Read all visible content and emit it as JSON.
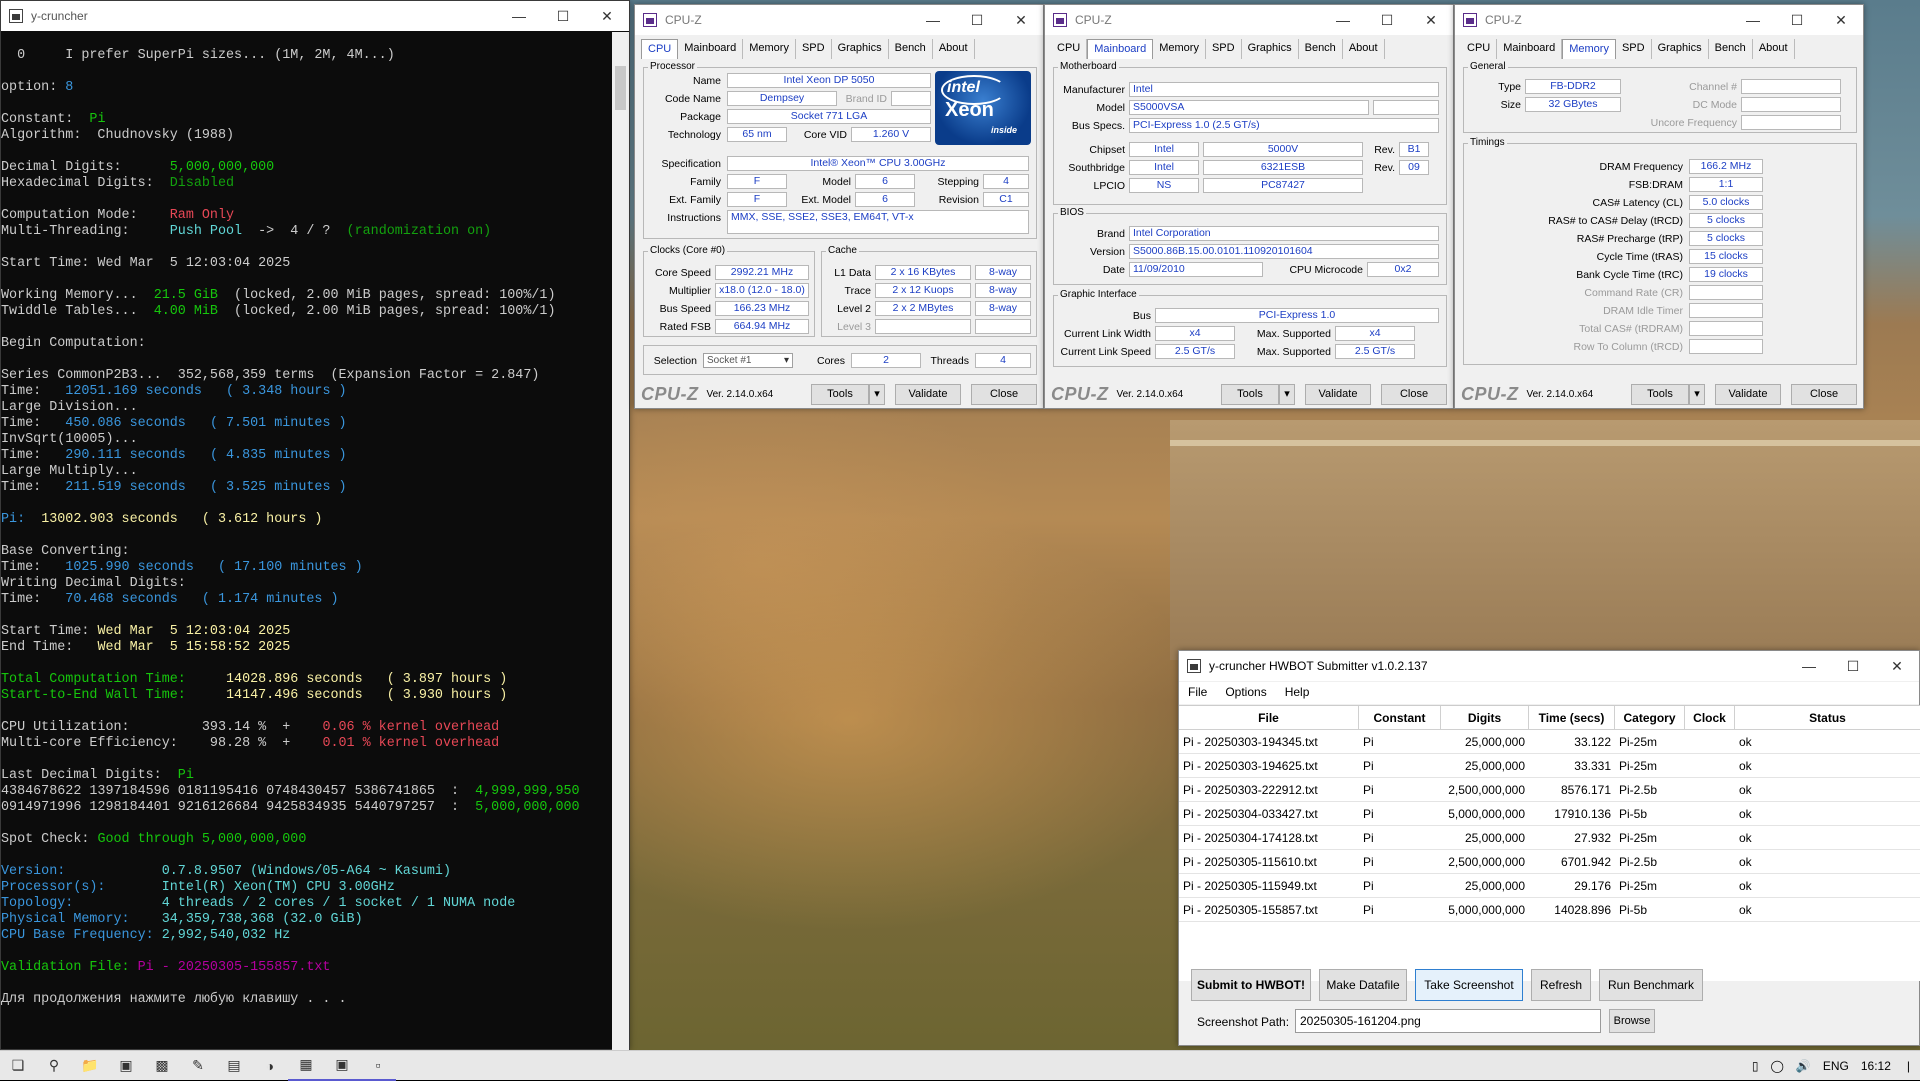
{
  "console": {
    "title": "y-cruncher",
    "lines": [
      [
        [
          "w",
          "  0     I prefer SuperPi sizes... (1M, 2M, 4M...)"
        ]
      ],
      [
        [
          "w",
          ""
        ]
      ],
      [
        [
          "w",
          "option: "
        ],
        [
          "c",
          "8"
        ]
      ],
      [
        [
          "w",
          ""
        ]
      ],
      [
        [
          "w",
          "Constant:  "
        ],
        [
          "g",
          "Pi"
        ]
      ],
      [
        [
          "w",
          "Algorithm:  Chudnovsky (1988)"
        ]
      ],
      [
        [
          "w",
          ""
        ]
      ],
      [
        [
          "w",
          "Decimal Digits:      "
        ],
        [
          "g",
          "5,000,000,000"
        ]
      ],
      [
        [
          "w",
          "Hexadecimal Digits:  "
        ],
        [
          "lg",
          "Disabled"
        ]
      ],
      [
        [
          "w",
          ""
        ]
      ],
      [
        [
          "w",
          "Computation Mode:    "
        ],
        [
          "r",
          "Ram Only"
        ]
      ],
      [
        [
          "w",
          "Multi-Threading:     "
        ],
        [
          "lc",
          "Push Pool"
        ],
        [
          "w",
          "  ->  4 / ?  "
        ],
        [
          "lg",
          "(randomization on)"
        ]
      ],
      [
        [
          "w",
          ""
        ]
      ],
      [
        [
          "w",
          "Start Time: Wed Mar  5 12:03:04 2025"
        ]
      ],
      [
        [
          "w",
          ""
        ]
      ],
      [
        [
          "w",
          "Working Memory...  "
        ],
        [
          "g",
          "21.5 GiB"
        ],
        [
          "w",
          "  (locked, 2.00 MiB pages, spread: 100%/1)"
        ]
      ],
      [
        [
          "w",
          "Twiddle Tables...  "
        ],
        [
          "g",
          "4.00 MiB"
        ],
        [
          "w",
          "  (locked, 2.00 MiB pages, spread: 100%/1)"
        ]
      ],
      [
        [
          "w",
          ""
        ]
      ],
      [
        [
          "w",
          "Begin Computation:"
        ]
      ],
      [
        [
          "w",
          ""
        ]
      ],
      [
        [
          "w",
          "Series CommonP2B3...  352,568,359 terms  (Expansion Factor = 2.847)"
        ]
      ],
      [
        [
          "w",
          "Time:   "
        ],
        [
          "c",
          "12051.169 seconds   ( 3.348 hours )"
        ]
      ],
      [
        [
          "w",
          "Large Division..."
        ]
      ],
      [
        [
          "w",
          "Time:   "
        ],
        [
          "c",
          "450.086 seconds   ( 7.501 minutes )"
        ]
      ],
      [
        [
          "w",
          "InvSqrt(10005)..."
        ]
      ],
      [
        [
          "w",
          "Time:   "
        ],
        [
          "c",
          "290.111 seconds   ( 4.835 minutes )"
        ]
      ],
      [
        [
          "w",
          "Large Multiply..."
        ]
      ],
      [
        [
          "w",
          "Time:   "
        ],
        [
          "c",
          "211.519 seconds   ( 3.525 minutes )"
        ]
      ],
      [
        [
          "w",
          ""
        ]
      ],
      [
        [
          "c",
          "Pi:  "
        ],
        [
          "y",
          "13002.903 seconds   ( 3.612 hours )"
        ]
      ],
      [
        [
          "w",
          ""
        ]
      ],
      [
        [
          "w",
          "Base Converting:"
        ]
      ],
      [
        [
          "w",
          "Time:   "
        ],
        [
          "c",
          "1025.990 seconds   ( 17.100 minutes )"
        ]
      ],
      [
        [
          "w",
          "Writing Decimal Digits:"
        ]
      ],
      [
        [
          "w",
          "Time:   "
        ],
        [
          "c",
          "70.468 seconds   ( 1.174 minutes )"
        ]
      ],
      [
        [
          "w",
          ""
        ]
      ],
      [
        [
          "w",
          "Start Time: "
        ],
        [
          "y",
          "Wed Mar  5 12:03:04 2025"
        ]
      ],
      [
        [
          "w",
          "End Time:   "
        ],
        [
          "y",
          "Wed Mar  5 15:58:52 2025"
        ]
      ],
      [
        [
          "w",
          ""
        ]
      ],
      [
        [
          "g",
          "Total Computation Time:     "
        ],
        [
          "y",
          "14028.896 seconds   ( 3.897 hours )"
        ]
      ],
      [
        [
          "g",
          "Start-to-End Wall Time:     "
        ],
        [
          "y",
          "14147.496 seconds   ( 3.930 hours )"
        ]
      ],
      [
        [
          "w",
          ""
        ]
      ],
      [
        [
          "w",
          "CPU Utilization:         393.14 %  +    "
        ],
        [
          "r",
          "0.06 % kernel overhead"
        ]
      ],
      [
        [
          "w",
          "Multi-core Efficiency:    98.28 %  +    "
        ],
        [
          "r",
          "0.01 % kernel overhead"
        ]
      ],
      [
        [
          "w",
          ""
        ]
      ],
      [
        [
          "w",
          "Last Decimal Digits:  "
        ],
        [
          "g",
          "Pi"
        ]
      ],
      [
        [
          "w",
          "4384678622 1397184596 0181195416 0748430457 5386741865  :  "
        ],
        [
          "g",
          "4,999,999,950"
        ]
      ],
      [
        [
          "w",
          "0914971996 1298184401 9216126684 9425834935 5440797257  :  "
        ],
        [
          "g",
          "5,000,000,000"
        ]
      ],
      [
        [
          "w",
          ""
        ]
      ],
      [
        [
          "w",
          "Spot Check: "
        ],
        [
          "g",
          "Good through 5,000,000,000"
        ]
      ],
      [
        [
          "w",
          ""
        ]
      ],
      [
        [
          "c",
          "Version:            "
        ],
        [
          "lc",
          "0.7.8.9507 (Windows/05-A64 ~ Kasumi)"
        ]
      ],
      [
        [
          "c",
          "Processor(s):       "
        ],
        [
          "lc",
          "Intel(R) Xeon(TM) CPU 3.00GHz"
        ]
      ],
      [
        [
          "c",
          "Topology:           "
        ],
        [
          "lc",
          "4 threads / 2 cores / 1 socket / 1 NUMA node"
        ]
      ],
      [
        [
          "c",
          "Physical Memory:    "
        ],
        [
          "lc",
          "34,359,738,368 (32.0 GiB)"
        ]
      ],
      [
        [
          "c",
          "CPU Base Frequency: "
        ],
        [
          "lc",
          "2,992,540,032 Hz"
        ]
      ],
      [
        [
          "w",
          ""
        ]
      ],
      [
        [
          "g",
          "Validation File: "
        ],
        [
          "m",
          "Pi - 20250305-155857.txt"
        ]
      ],
      [
        [
          "w",
          ""
        ]
      ],
      [
        [
          "w",
          "Для продолжения нажмите любую клавишу . . ."
        ]
      ]
    ]
  },
  "cpuz_common": {
    "title": "CPU-Z",
    "tabs": [
      "CPU",
      "Mainboard",
      "Memory",
      "SPD",
      "Graphics",
      "Bench",
      "About"
    ],
    "logo": "CPU-Z",
    "version": "Ver. 2.14.0.x64",
    "tools": "Tools",
    "validate": "Validate",
    "close": "Close"
  },
  "cpu": {
    "processor_group": "Processor",
    "name_l": "Name",
    "name": "Intel Xeon DP 5050",
    "code_l": "Code Name",
    "code": "Dempsey",
    "brand_l": "Brand ID",
    "pkg_l": "Package",
    "pkg": "Socket 771 LGA",
    "tech_l": "Technology",
    "tech": "65 nm",
    "vid_l": "Core VID",
    "vid": "1.260 V",
    "spec_l": "Specification",
    "spec": "Intel® Xeon™ CPU 3.00GHz",
    "fam_l": "Family",
    "fam": "F",
    "model_l": "Model",
    "model": "6",
    "step_l": "Stepping",
    "step": "4",
    "efam_l": "Ext. Family",
    "efam": "F",
    "emodel_l": "Ext. Model",
    "emodel": "6",
    "rev_l": "Revision",
    "rev": "C1",
    "instr_l": "Instructions",
    "instr": "MMX, SSE, SSE2, SSE3, EM64T, VT-x",
    "clocks_group": "Clocks (Core #0)",
    "cs_l": "Core Speed",
    "cs": "2992.21 MHz",
    "mul_l": "Multiplier",
    "mul": "x18.0 (12.0 - 18.0)",
    "bus_l": "Bus Speed",
    "bus": "166.23 MHz",
    "fsb_l": "Rated FSB",
    "fsb": "664.94 MHz",
    "cache_group": "Cache",
    "l1_l": "L1 Data",
    "l1": "2 x 16 KBytes",
    "l1w": "8-way",
    "tr_l": "Trace",
    "tr": "2 x 12 Kuops",
    "trw": "8-way",
    "l2_l": "Level 2",
    "l2": "2 x 2 MBytes",
    "l2w": "8-way",
    "l3_l": "Level 3",
    "sel_l": "Selection",
    "sel": "Socket #1",
    "cores_l": "Cores",
    "cores": "2",
    "threads_l": "Threads",
    "threads": "4",
    "intel_a": "intel",
    "intel_b": "Xeon",
    "intel_c": "inside"
  },
  "mb": {
    "mb_group": "Motherboard",
    "man_l": "Manufacturer",
    "man": "Intel",
    "mod_l": "Model",
    "mod": "S5000VSA",
    "bs_l": "Bus Specs.",
    "bs": "PCI-Express 1.0 (2.5 GT/s)",
    "chip_l": "Chipset",
    "chip_v": "Intel",
    "chip_m": "5000V",
    "rev_l": "Rev.",
    "chip_r": "B1",
    "sb_l": "Southbridge",
    "sb_v": "Intel",
    "sb_m": "6321ESB",
    "sb_r": "09",
    "lpcio_l": "LPCIO",
    "lpcio_v": "NS",
    "lpcio_m": "PC87427",
    "bios_group": "BIOS",
    "brand_l": "Brand",
    "brand": "Intel Corporation",
    "ver_l": "Version",
    "ver": "S5000.86B.15.00.0101.110920101604",
    "date_l": "Date",
    "date": "11/09/2010",
    "mc_l": "CPU Microcode",
    "mc": "0x2",
    "gi_group": "Graphic Interface",
    "gbus_l": "Bus",
    "gbus": "PCI-Express 1.0",
    "clw_l": "Current Link Width",
    "clw": "x4",
    "msw_l": "Max. Supported",
    "msw": "x4",
    "cls_l": "Current Link Speed",
    "cls": "2.5 GT/s",
    "mss_l": "Max. Supported",
    "mss": "2.5 GT/s"
  },
  "mem": {
    "gen_group": "General",
    "type_l": "Type",
    "type": "FB-DDR2",
    "ch_l": "Channel #",
    "size_l": "Size",
    "size": "32 GBytes",
    "dc_l": "DC Mode",
    "uf_l": "Uncore Frequency",
    "tim_group": "Timings",
    "t": [
      {
        "l": "DRAM Frequency",
        "v": "166.2 MHz",
        "dim": false
      },
      {
        "l": "FSB:DRAM",
        "v": "1:1",
        "dim": false
      },
      {
        "l": "CAS# Latency (CL)",
        "v": "5.0 clocks",
        "dim": false
      },
      {
        "l": "RAS# to CAS# Delay (tRCD)",
        "v": "5 clocks",
        "dim": false
      },
      {
        "l": "RAS# Precharge (tRP)",
        "v": "5 clocks",
        "dim": false
      },
      {
        "l": "Cycle Time (tRAS)",
        "v": "15 clocks",
        "dim": false
      },
      {
        "l": "Bank Cycle Time (tRC)",
        "v": "19 clocks",
        "dim": false
      },
      {
        "l": "Command Rate (CR)",
        "v": "",
        "dim": true
      },
      {
        "l": "DRAM Idle Timer",
        "v": "",
        "dim": true
      },
      {
        "l": "Total CAS# (tRDRAM)",
        "v": "",
        "dim": true
      },
      {
        "l": "Row To Column (tRCD)",
        "v": "",
        "dim": true
      }
    ]
  },
  "hwbot": {
    "title": "y-cruncher HWBOT Submitter v1.0.2.137",
    "menu": [
      "File",
      "Options",
      "Help"
    ],
    "cols": [
      "File",
      "Constant",
      "Digits",
      "Time (secs)",
      "Category",
      "Clock",
      "Status"
    ],
    "rows": [
      [
        "Pi - 20250303-194345.txt",
        "Pi",
        "25,000,000",
        "33.122",
        "Pi-25m",
        "",
        "ok"
      ],
      [
        "Pi - 20250303-194625.txt",
        "Pi",
        "25,000,000",
        "33.331",
        "Pi-25m",
        "",
        "ok"
      ],
      [
        "Pi - 20250303-222912.txt",
        "Pi",
        "2,500,000,000",
        "8576.171",
        "Pi-2.5b",
        "",
        "ok"
      ],
      [
        "Pi - 20250304-033427.txt",
        "Pi",
        "5,000,000,000",
        "17910.136",
        "Pi-5b",
        "",
        "ok"
      ],
      [
        "Pi - 20250304-174128.txt",
        "Pi",
        "25,000,000",
        "27.932",
        "Pi-25m",
        "",
        "ok"
      ],
      [
        "Pi - 20250305-115610.txt",
        "Pi",
        "2,500,000,000",
        "6701.942",
        "Pi-2.5b",
        "",
        "ok"
      ],
      [
        "Pi - 20250305-115949.txt",
        "Pi",
        "25,000,000",
        "29.176",
        "Pi-25m",
        "",
        "ok"
      ],
      [
        "Pi - 20250305-155857.txt",
        "Pi",
        "5,000,000,000",
        "14028.896",
        "Pi-5b",
        "",
        "ok"
      ]
    ],
    "buttons": [
      "Submit to HWBOT!",
      "Make Datafile",
      "Take Screenshot",
      "Refresh",
      "Run Benchmark"
    ],
    "path_label": "Screenshot Path:",
    "path": "20250305-161204.png",
    "browse": "Browse"
  },
  "tray": {
    "lang": "ENG",
    "time": "16:12"
  },
  "colors": {
    "w": "#cccccc",
    "g": "#16c60c",
    "y": "#f9f1a5",
    "c": "#3a96dd",
    "r": "#e74856",
    "m": "#b4009e",
    "lc": "#61d6d6",
    "lg": "#13a10e"
  }
}
